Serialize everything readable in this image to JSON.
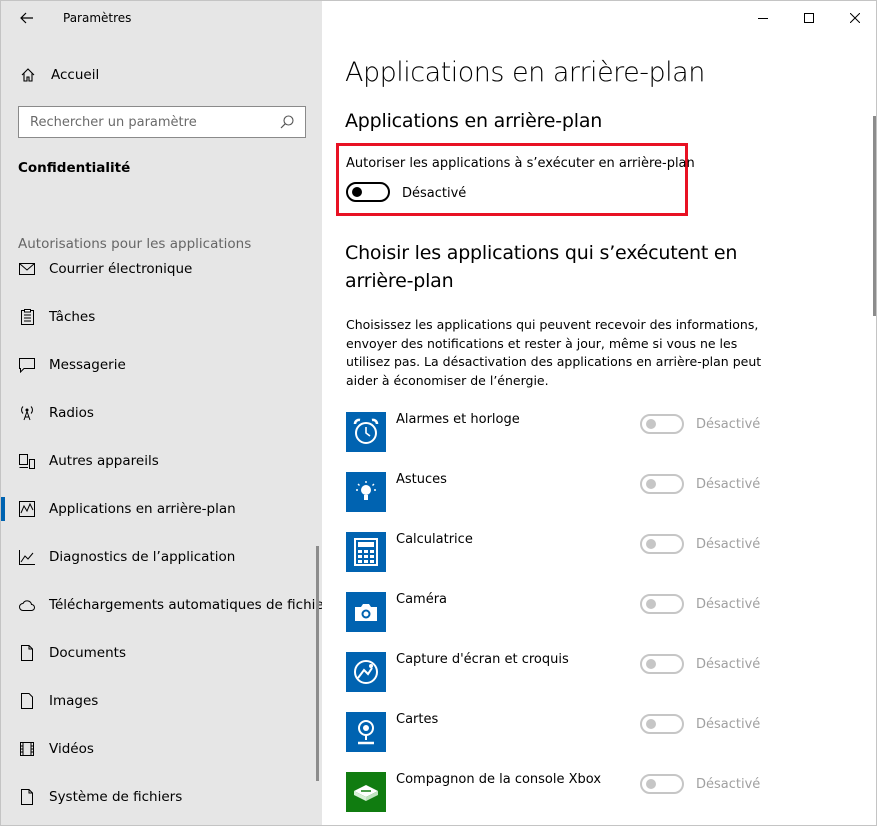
{
  "window": {
    "app_title": "Paramètres"
  },
  "sidebar": {
    "home_label": "Accueil",
    "search_placeholder": "Rechercher un paramètre",
    "section_title": "Confidentialité",
    "group_header": "Autorisations pour les applications",
    "items": [
      {
        "label": "Courrier électronique",
        "icon": "mail-icon"
      },
      {
        "label": "Tâches",
        "icon": "tasks-icon"
      },
      {
        "label": "Messagerie",
        "icon": "messaging-icon"
      },
      {
        "label": "Radios",
        "icon": "radio-icon"
      },
      {
        "label": "Autres appareils",
        "icon": "devices-icon"
      },
      {
        "label": "Applications en arrière-plan",
        "icon": "background-apps-icon",
        "selected": true
      },
      {
        "label": "Diagnostics de l’application",
        "icon": "diagnostics-icon"
      },
      {
        "label": "Téléchargements automatiques de fichiers",
        "icon": "cloud-icon"
      },
      {
        "label": "Documents",
        "icon": "document-icon"
      },
      {
        "label": "Images",
        "icon": "image-icon"
      },
      {
        "label": "Vidéos",
        "icon": "video-icon"
      },
      {
        "label": "Système de fichiers",
        "icon": "filesystem-icon"
      }
    ]
  },
  "main": {
    "page_title": "Applications en arrière-plan",
    "sub_title": "Applications en arrière-plan",
    "allow_label": "Autoriser les applications à s’exécuter en arrière-plan",
    "allow_state": "Désactivé",
    "choose_title": "Choisir les applications qui s’exécutent en arrière-plan",
    "description": "Choisissez les applications qui peuvent recevoir des informations, envoyer des notifications et rester à jour, même si vous ne les utilisez pas. La désactivation des applications en arrière-plan peut aider à économiser de l’énergie.",
    "apps": [
      {
        "name": "Alarmes et horloge",
        "state": "Désactivé",
        "icon": "alarm-clock-icon",
        "color": "#0063b1"
      },
      {
        "name": "Astuces",
        "state": "Désactivé",
        "icon": "lightbulb-icon",
        "color": "#0063b1"
      },
      {
        "name": "Calculatrice",
        "state": "Désactivé",
        "icon": "calculator-icon",
        "color": "#0063b1"
      },
      {
        "name": "Caméra",
        "state": "Désactivé",
        "icon": "camera-icon",
        "color": "#0063b1"
      },
      {
        "name": "Capture d'écran et croquis",
        "state": "Désactivé",
        "icon": "snip-sketch-icon",
        "color": "#0063b1"
      },
      {
        "name": "Cartes",
        "state": "Désactivé",
        "icon": "maps-icon",
        "color": "#0063b1"
      },
      {
        "name": "Compagnon de la console Xbox",
        "state": "Désactivé",
        "icon": "xbox-icon",
        "color": "#107c10"
      }
    ]
  },
  "colors": {
    "accent": "#0063b1",
    "highlight_border": "#e81123",
    "sidebar_bg": "#e6e6e6"
  }
}
